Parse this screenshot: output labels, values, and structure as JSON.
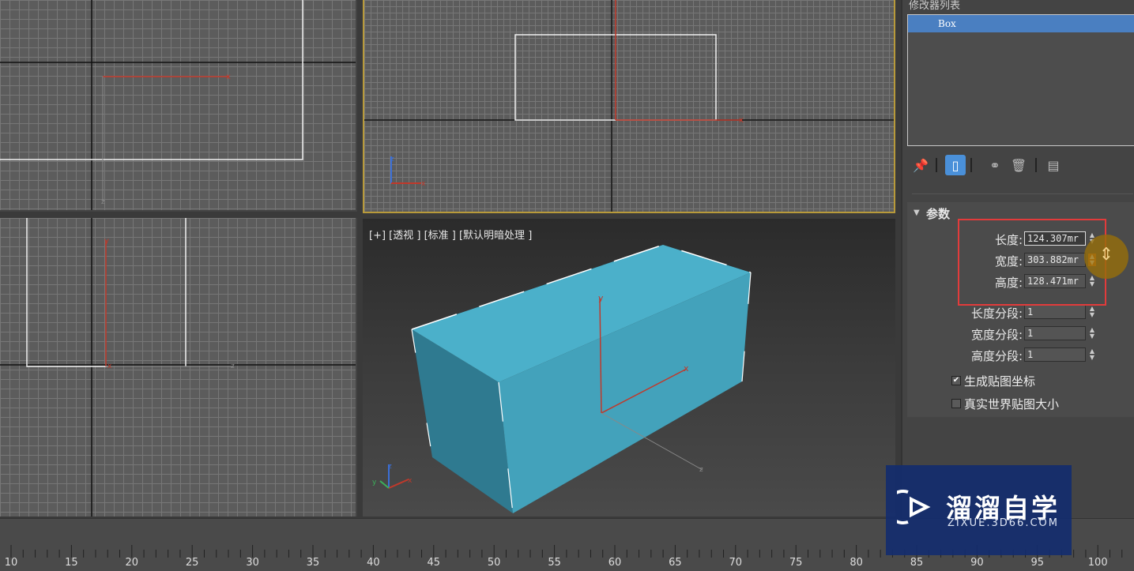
{
  "viewports": {
    "perspective_label": "[+] [透视 ] [标准 ] [默认明暗处理 ]"
  },
  "axes": {
    "x": "x",
    "y": "y",
    "z": "z"
  },
  "panel": {
    "header": "修改器列表",
    "modifier_stack": [
      "Box"
    ],
    "rollout_title": "参数",
    "params": [
      {
        "label": "长度:",
        "value": "124.307mr"
      },
      {
        "label": "宽度:",
        "value": "303.882mr"
      },
      {
        "label": "高度:",
        "value": "128.471mr"
      },
      {
        "label": "长度分段:",
        "value": "1"
      },
      {
        "label": "宽度分段:",
        "value": "1"
      },
      {
        "label": "高度分段:",
        "value": "1"
      }
    ],
    "checkboxes": [
      {
        "label": "生成贴图坐标",
        "checked": true,
        "mark": "✔"
      },
      {
        "label": "真实世界贴图大小",
        "checked": false,
        "mark": ""
      }
    ]
  },
  "timeline": {
    "ticks": [
      "10",
      "15",
      "20",
      "25",
      "30",
      "35",
      "40",
      "45",
      "50",
      "55",
      "60",
      "65",
      "70",
      "75",
      "80",
      "85",
      "90",
      "95",
      "100"
    ]
  },
  "watermark": {
    "title": "溜溜自学",
    "url": "ZIXUE.3D66.COM"
  },
  "icons": [
    "pin-icon",
    "show-end-result-icon",
    "make-unique-icon",
    "remove-modifier-icon",
    "configure-sets-icon",
    "cursor-icon"
  ],
  "colors": {
    "box_fill": "#47a9c4",
    "highlight": "#e23b3b",
    "selection": "#4a7fc1",
    "active_viewport_border": "#b89a3a"
  }
}
